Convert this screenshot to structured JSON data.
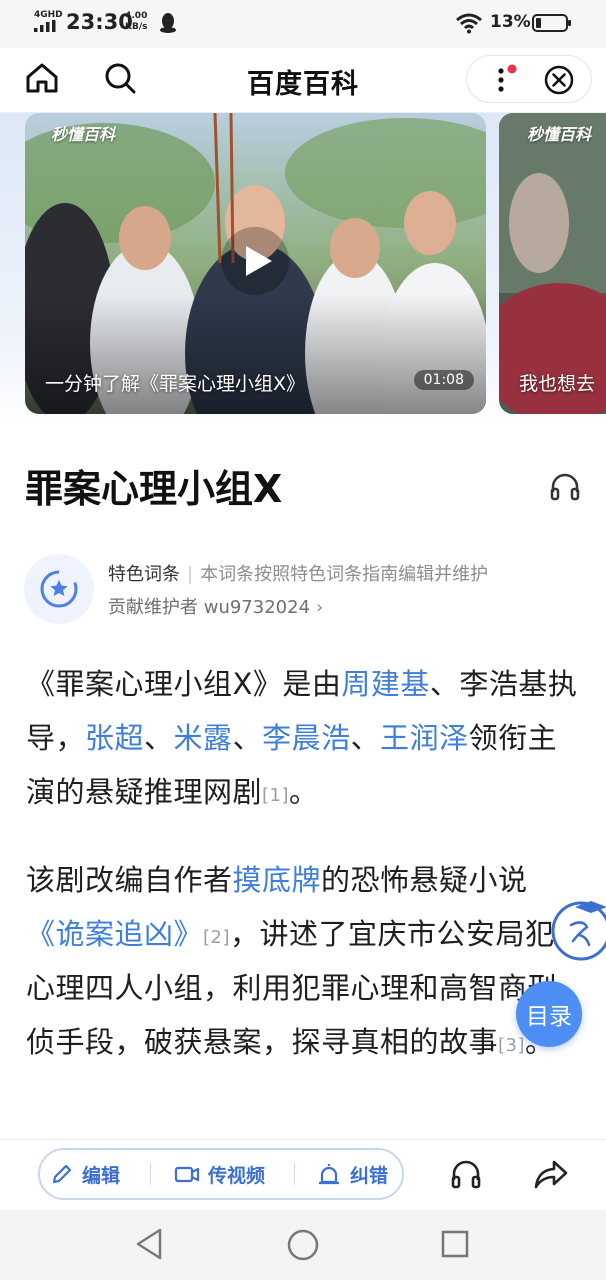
{
  "status_bar": {
    "network": "4GHD",
    "time": "23:30",
    "speed_value": "4.00",
    "speed_unit": "KB/s",
    "battery_percent": "13%"
  },
  "header": {
    "title": "百度百科"
  },
  "videos": [
    {
      "logo": "秒懂百科",
      "caption": "一分钟了解《罪案心理小组X》",
      "duration": "01:08"
    },
    {
      "logo": "秒懂百科",
      "caption": "我也想去"
    }
  ],
  "entry": {
    "title": "罪案心理小组X",
    "badge_tag": "特色词条",
    "badge_desc": "本词条按照特色词条指南编辑并维护",
    "contributor": "贡献维护者 wu9732024"
  },
  "para1": {
    "t1": "《罪案心理小组X》是由",
    "link1": "周建基",
    "t2": "、李浩基执导，",
    "link2": "张超",
    "t3": "、",
    "link3": "米露",
    "t4": "、",
    "link4": "李晨浩",
    "t5": "、",
    "link5": "王润泽",
    "t6": "领衔主演的悬疑推理网剧",
    "ref": "[1]",
    "t7": "。"
  },
  "para2": {
    "t1": "该剧改编自作者",
    "link1": "摸底牌",
    "t2": "的恐怖悬疑小说",
    "link2": "《诡案追凶》",
    "ref1": "[2]",
    "t3": "，讲述了宜庆市公安局犯罪心理四人小组，利用犯罪心理和高智商刑侦手段，破获悬案，探寻真相的故事",
    "ref2": "[3]",
    "t4": "。"
  },
  "floating": {
    "toc_label": "目录"
  },
  "toolbar": {
    "edit_label": "编辑",
    "video_label": "传视频",
    "fix_label": "纠错"
  },
  "colors": {
    "link": "#3f7fd9",
    "accent": "#4d8ef4"
  }
}
